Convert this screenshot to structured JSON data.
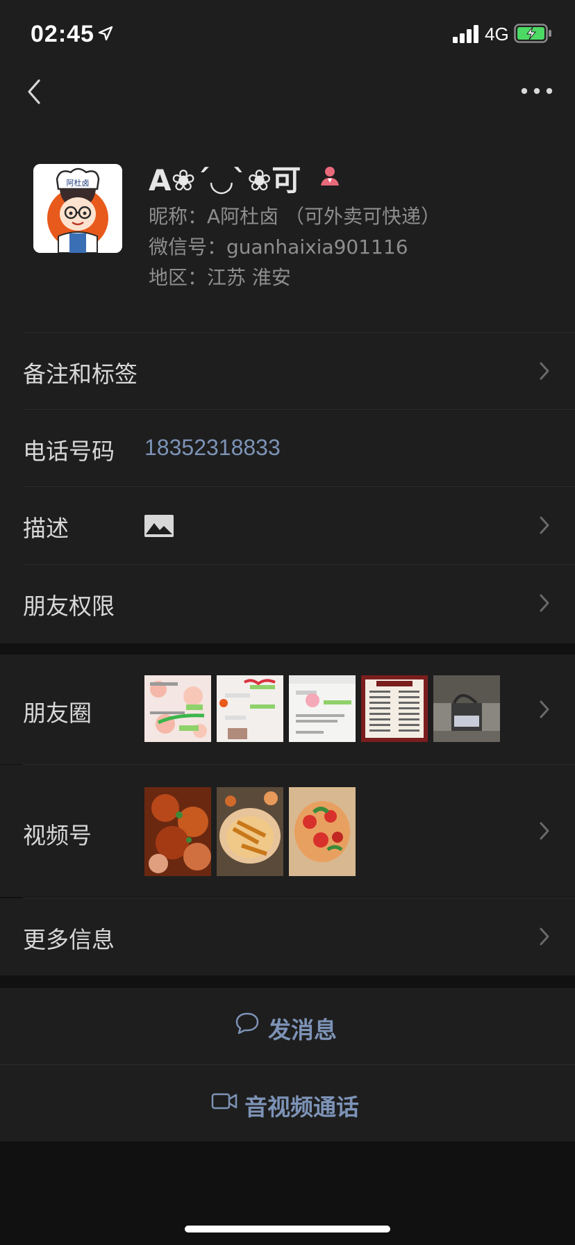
{
  "status_bar": {
    "time": "02:45",
    "network": "4G",
    "icons": [
      "location-arrow-icon",
      "signal-icon",
      "battery-charging-icon"
    ]
  },
  "nav": {
    "back_icon": "chevron-left-icon",
    "more_icon": "more-dots-icon"
  },
  "profile": {
    "display_name": "A❀ˊ◡ˋ❀可",
    "gender_icon": "female-icon",
    "nickname": "昵称：A阿杜卤 （可外卖可快递）",
    "wechat_id": "微信号：guanhaixia901116",
    "region": "地区：江苏 淮安",
    "avatar_text": "阿杜卤"
  },
  "rows": {
    "remark": {
      "label": "备注和标签"
    },
    "phone": {
      "label": "电话号码",
      "value": "18352318833"
    },
    "description": {
      "label": "描述",
      "icon": "image-icon"
    },
    "permissions": {
      "label": "朋友权限"
    },
    "moments": {
      "label": "朋友圈",
      "thumbnails": 5
    },
    "channels": {
      "label": "视频号",
      "thumbnails": 3
    },
    "more_info": {
      "label": "更多信息"
    }
  },
  "actions": {
    "send_message": {
      "label": "发消息",
      "icon": "chat-bubble-icon"
    },
    "call": {
      "label": "音视频通话",
      "icon": "video-camera-icon"
    }
  },
  "colors": {
    "background": "#111111",
    "panel": "#1e1e1e",
    "link": "#7d93b7",
    "text": "#d8d8d8",
    "muted": "#8e8e8e",
    "gender": "#e8697a"
  }
}
